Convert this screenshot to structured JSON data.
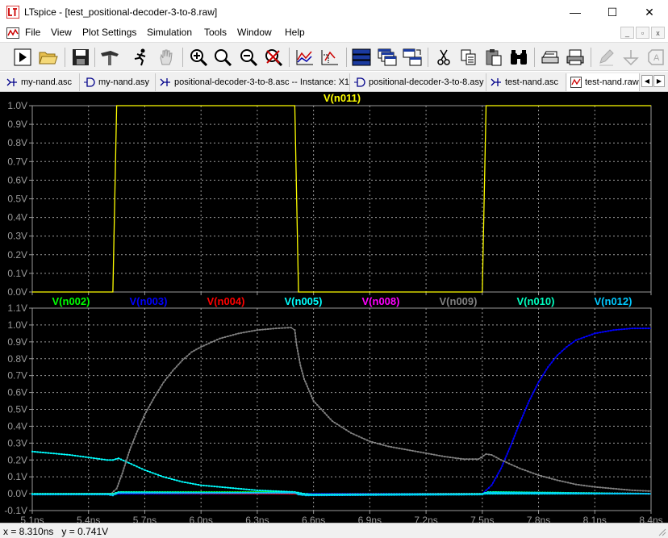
{
  "window": {
    "title": "LTspice - [test_positional-decoder-3-to-8.raw]",
    "minimize": "—",
    "maximize": "☐",
    "close": "✕"
  },
  "menu": [
    "File",
    "View",
    "Plot Settings",
    "Simulation",
    "Tools",
    "Window",
    "Help"
  ],
  "mdi_buttons": [
    "_",
    "▫",
    "x"
  ],
  "toolbar_icons": [
    "run-icon",
    "open-icon",
    "save-icon",
    "hammer-icon",
    "running-man-icon",
    "hand-icon",
    "zoom-in-icon",
    "zoom-area-icon",
    "zoom-out-icon",
    "zoom-cancel-icon",
    "autorange-icon",
    "mark-icon",
    "tile-horizontal-icon",
    "cascade-icon",
    "tile-vertical-icon",
    "cut-icon",
    "copy-icon",
    "paste-icon",
    "find-icon",
    "print-preview-icon",
    "print-icon",
    "pencil-icon",
    "ground-icon",
    "label-icon"
  ],
  "tabs": [
    {
      "label": "my-nand.asc",
      "icon": "schematic"
    },
    {
      "label": "my-nand.asy",
      "icon": "symbol"
    },
    {
      "label": "positional-decoder-3-to-8.asc -- Instance: X1",
      "icon": "schematic"
    },
    {
      "label": "positional-decoder-3-to-8.asy",
      "icon": "symbol"
    },
    {
      "label": "test-nand.asc",
      "icon": "schematic"
    },
    {
      "label": "test-nand.raw",
      "icon": "waveform"
    }
  ],
  "status": {
    "x": "x = 8.310ns",
    "y": "y = 0.741V"
  },
  "colors": {
    "background": "#000000",
    "grid": "#9a9a9a",
    "axis_text": "#9a9a9a",
    "n011": "#ffff00",
    "n002": "#00ff00",
    "n003": "#0000ff",
    "n004": "#ff0000",
    "n005": "#00ffff",
    "n008": "#ff00ff",
    "n009": "#808080",
    "n010": "#00ffc0",
    "n012": "#00c8ff"
  },
  "chart_data": [
    {
      "type": "line",
      "xlim": [
        5.1,
        8.4
      ],
      "ylim": [
        0.0,
        1.0
      ],
      "yticks": [
        0.0,
        0.1,
        0.2,
        0.3,
        0.4,
        0.5,
        0.6,
        0.7,
        0.8,
        0.9,
        1.0
      ],
      "ytick_labels": [
        "0.0V",
        "0.1V",
        "0.2V",
        "0.3V",
        "0.4V",
        "0.5V",
        "0.6V",
        "0.7V",
        "0.8V",
        "0.9V",
        "1.0V"
      ],
      "grid": true,
      "series": [
        {
          "name": "V(n011)",
          "color": "#ffff00",
          "markers": false,
          "x": [
            5.1,
            5.53,
            5.55,
            6.5,
            6.52,
            7.5,
            7.52,
            8.4
          ],
          "y": [
            0.0,
            0.0,
            1.0,
            1.0,
            0.0,
            0.0,
            1.0,
            1.0
          ]
        }
      ]
    },
    {
      "type": "line",
      "xlim": [
        5.1,
        8.4
      ],
      "ylim": [
        -0.1,
        1.1
      ],
      "xticks": [
        5.1,
        5.4,
        5.7,
        6.0,
        6.3,
        6.6,
        6.9,
        7.2,
        7.5,
        7.8,
        8.1,
        8.4
      ],
      "xtick_labels": [
        "5.1ns",
        "5.4ns",
        "5.7ns",
        "6.0ns",
        "6.3ns",
        "6.6ns",
        "6.9ns",
        "7.2ns",
        "7.5ns",
        "7.8ns",
        "8.1ns",
        "8.4ns"
      ],
      "yticks": [
        -0.1,
        0.0,
        0.1,
        0.2,
        0.3,
        0.4,
        0.5,
        0.6,
        0.7,
        0.8,
        0.9,
        1.0,
        1.1
      ],
      "ytick_labels": [
        "-0.1V",
        "0.0V",
        "0.1V",
        "0.2V",
        "0.3V",
        "0.4V",
        "0.5V",
        "0.6V",
        "0.7V",
        "0.8V",
        "0.9V",
        "1.0V",
        "1.1V"
      ],
      "grid": true,
      "series": [
        {
          "name": "V(n002)",
          "color": "#00ff00",
          "markers": true,
          "x": [
            5.1,
            5.5,
            5.53,
            5.56,
            5.6,
            6.5,
            6.52,
            6.56,
            7.5,
            7.53,
            7.56,
            8.4
          ],
          "y": [
            0.0,
            0.0,
            -0.005,
            0.01,
            0.01,
            0.01,
            0.005,
            -0.005,
            -0.005,
            0.005,
            0.01,
            0.0
          ]
        },
        {
          "name": "V(n003)",
          "color": "#0000ff",
          "markers": true,
          "x": [
            5.1,
            7.5,
            7.52,
            7.55,
            7.6,
            7.65,
            7.7,
            7.75,
            7.8,
            7.85,
            7.9,
            7.95,
            8.0,
            8.1,
            8.2,
            8.3,
            8.4
          ],
          "y": [
            0.0,
            0.0,
            0.02,
            0.05,
            0.15,
            0.28,
            0.42,
            0.55,
            0.66,
            0.75,
            0.82,
            0.87,
            0.91,
            0.95,
            0.97,
            0.98,
            0.98
          ]
        },
        {
          "name": "V(n004)",
          "color": "#ff0000",
          "markers": true,
          "x": [
            5.1,
            5.53,
            5.56,
            6.5,
            6.53,
            7.5,
            7.53,
            8.4
          ],
          "y": [
            0.0,
            0.0,
            0.005,
            0.0,
            -0.005,
            0.0,
            0.005,
            0.0
          ]
        },
        {
          "name": "V(n005)",
          "color": "#00ffff",
          "markers": true,
          "x": [
            5.1,
            5.3,
            5.5,
            5.53,
            5.56,
            5.6,
            5.7,
            5.8,
            5.9,
            6.0,
            6.1,
            6.2,
            6.3,
            6.4,
            6.5,
            6.55,
            6.6,
            6.8,
            7.0,
            7.2,
            7.4,
            7.5,
            8.4
          ],
          "y": [
            0.25,
            0.23,
            0.2,
            0.2,
            0.21,
            0.19,
            0.14,
            0.1,
            0.07,
            0.05,
            0.04,
            0.03,
            0.02,
            0.015,
            0.01,
            0.0,
            -0.005,
            -0.005,
            -0.005,
            -0.005,
            -0.005,
            0.0,
            0.0
          ]
        },
        {
          "name": "V(n008)",
          "color": "#ff00ff",
          "markers": true,
          "x": [
            5.1,
            5.53,
            5.56,
            6.5,
            6.53,
            7.5,
            7.53,
            8.4
          ],
          "y": [
            0.0,
            0.0,
            0.008,
            0.005,
            -0.005,
            0.0,
            0.008,
            0.0
          ]
        },
        {
          "name": "V(n009)",
          "color": "#808080",
          "markers": true,
          "x": [
            5.1,
            5.52,
            5.55,
            5.58,
            5.62,
            5.66,
            5.7,
            5.75,
            5.8,
            5.85,
            5.9,
            5.95,
            6.0,
            6.1,
            6.2,
            6.3,
            6.4,
            6.48,
            6.5,
            6.51,
            6.53,
            6.55,
            6.6,
            6.7,
            6.8,
            6.9,
            7.0,
            7.1,
            7.2,
            7.3,
            7.4,
            7.48,
            7.52,
            7.55,
            7.6,
            7.7,
            7.8,
            7.9,
            8.0,
            8.1,
            8.2,
            8.3,
            8.4
          ],
          "y": [
            0.0,
            0.0,
            0.03,
            0.12,
            0.26,
            0.37,
            0.47,
            0.57,
            0.66,
            0.73,
            0.79,
            0.84,
            0.87,
            0.92,
            0.95,
            0.97,
            0.98,
            0.985,
            0.97,
            0.88,
            0.76,
            0.68,
            0.55,
            0.43,
            0.36,
            0.31,
            0.28,
            0.26,
            0.24,
            0.22,
            0.205,
            0.205,
            0.235,
            0.23,
            0.2,
            0.15,
            0.11,
            0.08,
            0.055,
            0.04,
            0.03,
            0.02,
            0.015
          ]
        },
        {
          "name": "V(n010)",
          "color": "#00ffc0",
          "markers": true,
          "x": [
            5.1,
            5.53,
            5.56,
            6.5,
            6.53,
            7.5,
            7.53,
            8.4
          ],
          "y": [
            0.0,
            0.0,
            0.01,
            0.005,
            -0.005,
            0.0,
            0.01,
            0.0
          ]
        },
        {
          "name": "V(n012)",
          "color": "#00c8ff",
          "markers": true,
          "x": [
            5.1,
            5.5,
            5.53,
            5.56,
            6.5,
            6.52,
            6.56,
            7.5,
            7.53,
            8.4
          ],
          "y": [
            -0.005,
            -0.005,
            -0.01,
            0.005,
            0.005,
            -0.005,
            -0.01,
            -0.005,
            0.005,
            0.0
          ]
        }
      ]
    }
  ]
}
